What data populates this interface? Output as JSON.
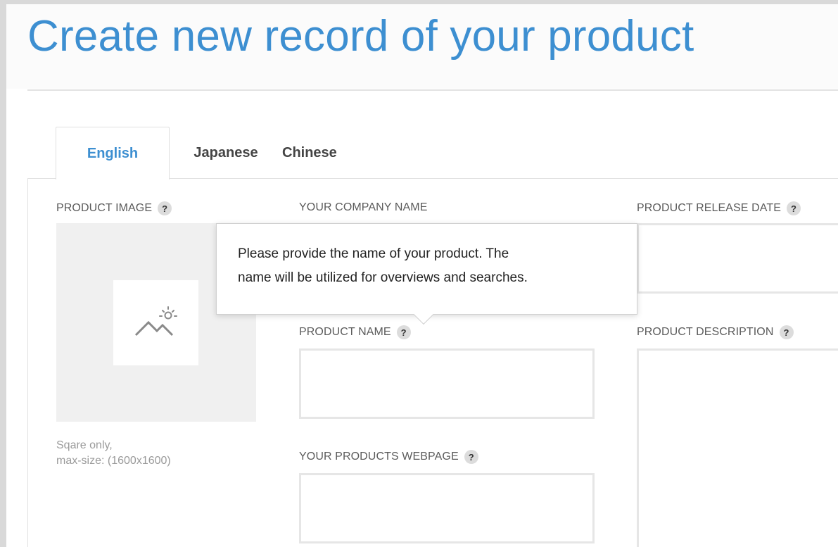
{
  "page": {
    "title": "Create new record of your product"
  },
  "tabs": [
    {
      "label": "English",
      "active": true
    },
    {
      "label": "Japanese",
      "active": false
    },
    {
      "label": "Chinese",
      "active": false
    }
  ],
  "fields": {
    "product_image": {
      "label": "PRODUCT IMAGE",
      "hint_line1": "Sqare only,",
      "hint_line2": "max-size: (1600x1600)"
    },
    "company_name": {
      "label": "YOUR COMPANY NAME",
      "value": ""
    },
    "release_date": {
      "label": "PRODUCT RELEASE DATE",
      "value": ""
    },
    "product_name": {
      "label": "PRODUCT NAME",
      "value": ""
    },
    "description": {
      "label": "PRODUCT DESCRIPTION",
      "value": ""
    },
    "webpage": {
      "label": "YOUR PRODUCTS WEBPAGE",
      "value": ""
    }
  },
  "help_icon_glyph": "?",
  "tooltip": {
    "line1": "Please provide the name of your product. The",
    "line2": "name will be utilized for overviews and searches."
  },
  "colors": {
    "accent": "#3d8fd1",
    "label": "#5b5b5b",
    "hint": "#9a9a9a",
    "field_border": "#e6e6e6"
  },
  "icons": {
    "image_placeholder": "image-placeholder-icon",
    "help": "help-icon"
  }
}
